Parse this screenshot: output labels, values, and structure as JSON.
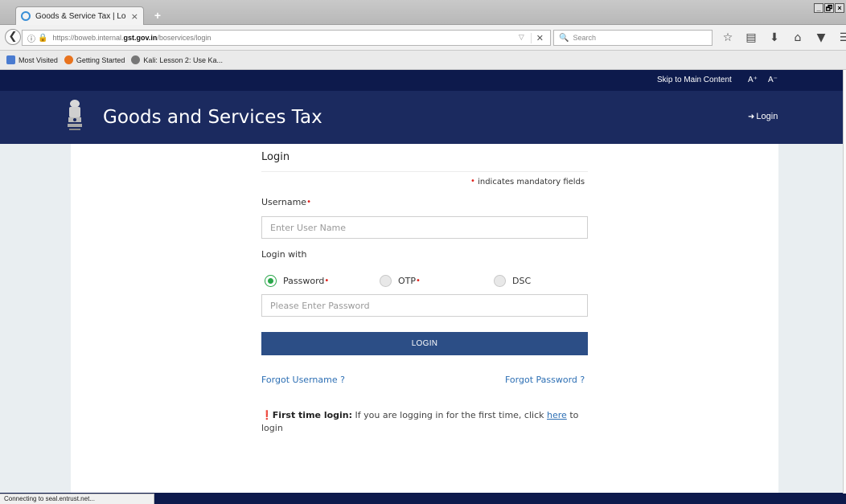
{
  "browser": {
    "tab_title": "Goods & Service Tax | Login",
    "tab_close": "×",
    "new_tab": "+",
    "window_controls": [
      "_",
      "🗗",
      "×"
    ],
    "url_host_prefix": "https://boweb.internal.",
    "url_host_bold": "gst.gov.in",
    "url_path": "/boservices/login",
    "search_placeholder": "Search",
    "bookmarks": [
      {
        "label": "Most Visited",
        "icon": "folder-icon",
        "color": "#4a7bd0"
      },
      {
        "label": "Getting Started",
        "icon": "firefox-icon",
        "color": "#e8731e"
      },
      {
        "label": "Kali: Lesson 2: Use Ka...",
        "icon": "kali-icon",
        "color": "#777777"
      }
    ],
    "status_text": "Connecting to seal.entrust.net..."
  },
  "site": {
    "skip_link": "Skip to Main Content",
    "font_increase": "A⁺",
    "font_decrease": "A⁻",
    "title": "Goods and Services Tax",
    "header_login": "Login",
    "colors": {
      "top_strip": "#0d1a4c",
      "header": "#1b2a5f",
      "button": "#2c4e86",
      "link": "#2d6fb4",
      "radio_on": "#2aa64a",
      "required": "#e0201a"
    }
  },
  "login": {
    "heading": "Login",
    "mandatory_note": "indicates mandatory fields",
    "required_marker": "•",
    "username_label": "Username",
    "username_placeholder": "Enter User Name",
    "login_with_label": "Login with",
    "options": [
      {
        "label": "Password",
        "selected": true,
        "required": true
      },
      {
        "label": "OTP",
        "selected": false,
        "required": true
      },
      {
        "label": "DSC",
        "selected": false,
        "required": false
      }
    ],
    "password_placeholder": "Please Enter Password",
    "submit_label": "LOGIN",
    "forgot_username": "Forgot Username ?",
    "forgot_password": "Forgot Password ?",
    "first_time_bold": "First time login:",
    "first_time_text": "If you are logging in for the first time, click",
    "first_time_link": "here",
    "first_time_suffix": "to login"
  }
}
